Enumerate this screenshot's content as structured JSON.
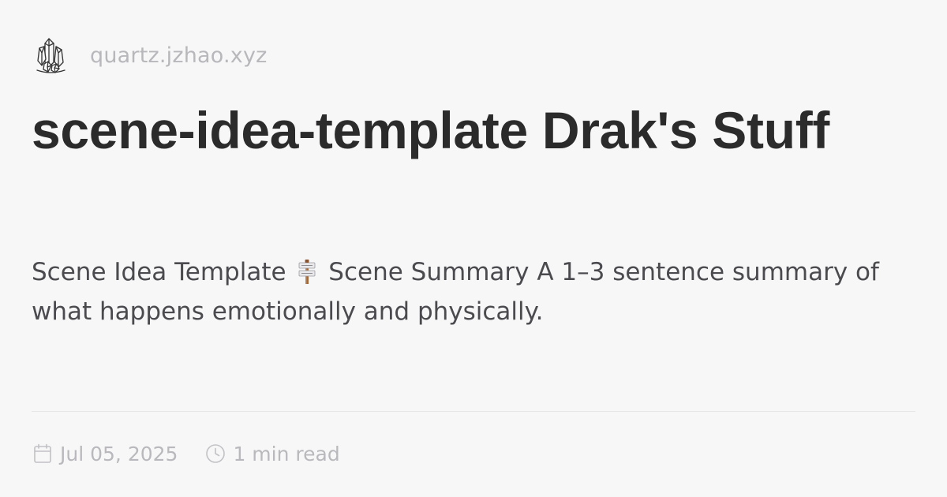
{
  "site": {
    "logo_icon": "crystal-cluster-icon",
    "url": "quartz.jzhao.xyz"
  },
  "page": {
    "title": "scene-idea-template Drak's Stuff",
    "description_before": "Scene Idea Template",
    "description_emoji": "signpost-icon",
    "description_after": "Scene Summary A 1–3 sentence summary of what happens emotionally and physically."
  },
  "meta": {
    "date_icon": "calendar-icon",
    "date": "Jul 05, 2025",
    "read_icon": "clock-icon",
    "reading_time": "1 min read"
  },
  "colors": {
    "background": "#f8f7f8",
    "title": "#2b2b2b",
    "description": "#4b4b4f",
    "muted": "#b8b7bb",
    "divider": "#e6e5e8"
  }
}
